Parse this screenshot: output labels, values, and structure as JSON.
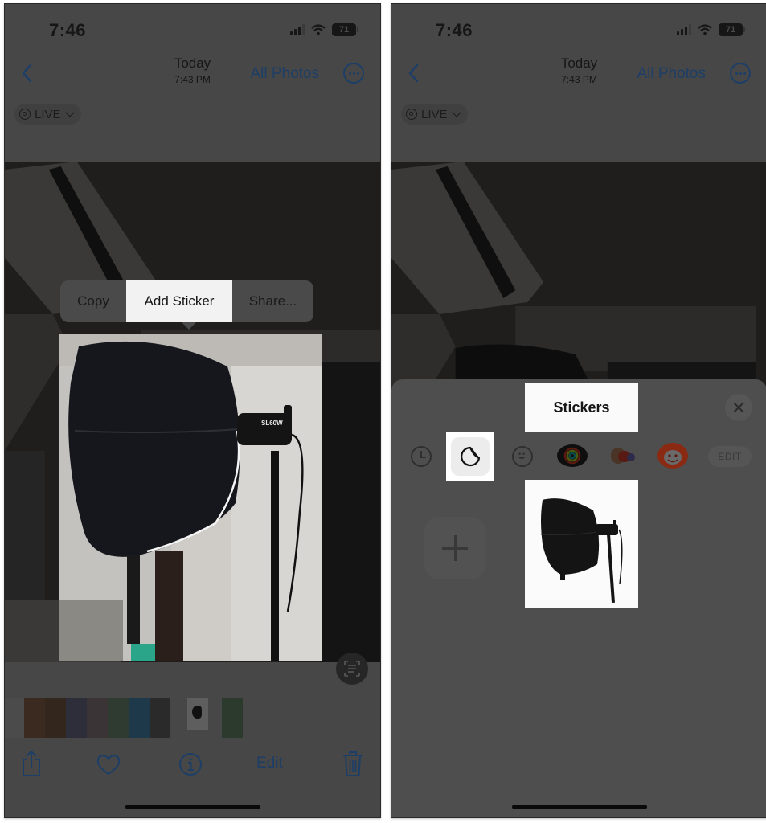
{
  "screens": [
    {
      "status_bar": {
        "time": "7:46",
        "battery": "71"
      },
      "nav": {
        "title": "Today",
        "subtitle": "7:43 PM",
        "all_photos": "All Photos"
      },
      "live_badge": "LIVE",
      "context_menu": {
        "items": [
          "Copy",
          "Add Sticker",
          "Share..."
        ],
        "highlighted": "Add Sticker"
      },
      "toolbar": {
        "edit": "Edit"
      }
    },
    {
      "status_bar": {
        "time": "7:46",
        "battery": "71"
      },
      "nav": {
        "title": "Today",
        "subtitle": "7:43 PM",
        "all_photos": "All Photos"
      },
      "live_badge": "LIVE",
      "sticker_sheet": {
        "title": "Stickers",
        "categories": [
          "recents-icon",
          "stickers-icon",
          "emoji-icon",
          "app-sticker-1",
          "app-sticker-2",
          "app-sticker-3"
        ],
        "selected_category": "stickers-icon",
        "edit_label": "EDIT"
      }
    }
  ],
  "colors": {
    "accent_dimmed": "#1d3e66",
    "highlight": "#f2f2f2",
    "overlay": "#474747"
  }
}
